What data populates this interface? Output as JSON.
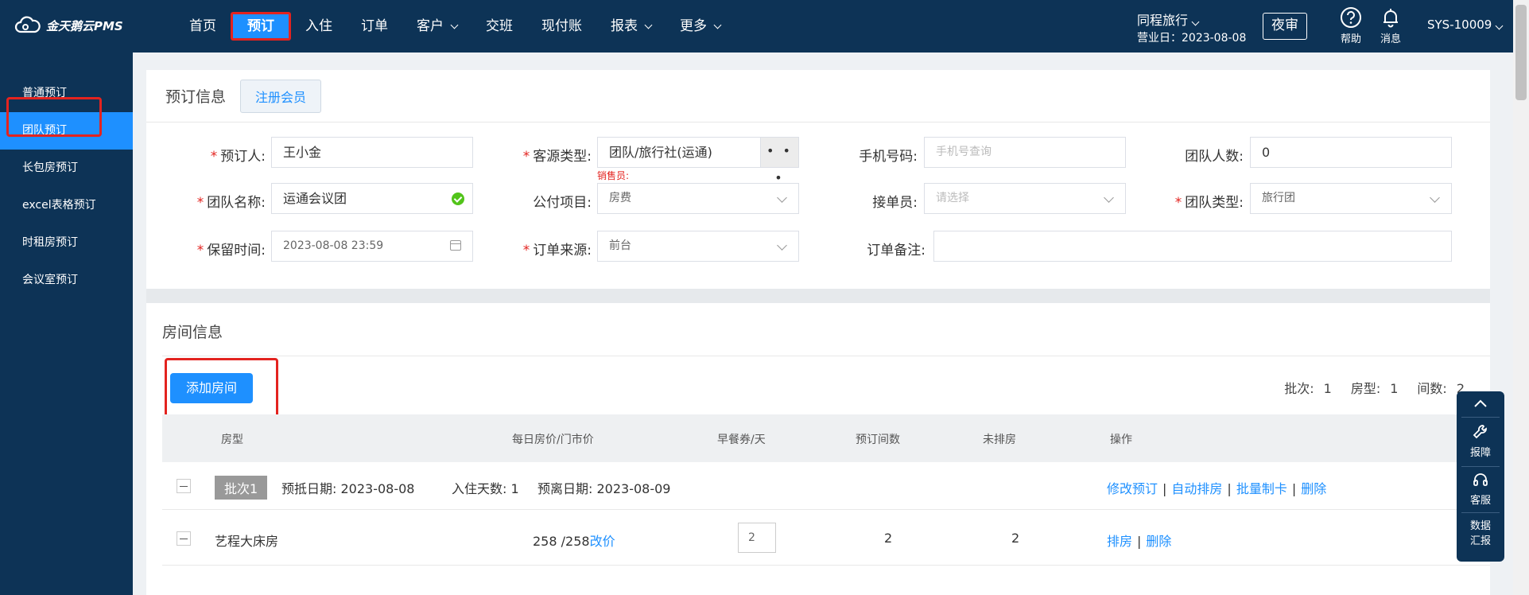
{
  "app": {
    "logo_text": "金天鹅云PMS"
  },
  "nav": {
    "items": [
      {
        "label": "首页",
        "caret": false
      },
      {
        "label": "预订",
        "caret": false,
        "active": true
      },
      {
        "label": "入住",
        "caret": false
      },
      {
        "label": "订单",
        "caret": false
      },
      {
        "label": "客户",
        "caret": true
      },
      {
        "label": "交班",
        "caret": false
      },
      {
        "label": "现付账",
        "caret": false
      },
      {
        "label": "报表",
        "caret": true
      },
      {
        "label": "更多",
        "caret": true
      }
    ]
  },
  "header": {
    "hotel_name": "同程旅行",
    "business_date": "营业日：2023-08-08",
    "night_audit": "夜审",
    "help_label": "帮助",
    "message_label": "消息",
    "user": "SYS-10009"
  },
  "sidebar": {
    "items": [
      {
        "label": "普通预订"
      },
      {
        "label": "团队预订",
        "active": true
      },
      {
        "label": "长包房预订"
      },
      {
        "label": "excel表格预订"
      },
      {
        "label": "时租房预订"
      },
      {
        "label": "会议室预订"
      }
    ]
  },
  "booking": {
    "title": "预订信息",
    "register_member": "注册会员",
    "booker_label": "预订人:",
    "booker_value": "王小金",
    "source_label": "客源类型:",
    "source_value": "团队/旅行社(运通)",
    "dots": "• • •",
    "sales_label": "销售员:",
    "phone_label": "手机号码:",
    "phone_placeholder": "手机号查询",
    "team_size_label": "团队人数:",
    "team_size_value": "0",
    "team_name_label": "团队名称:",
    "team_name_value": "运通会议团",
    "payment_label": "公付项目:",
    "payment_value": "房费",
    "receiver_label": "接单员:",
    "receiver_placeholder": "请选择",
    "team_type_label": "团队类型:",
    "team_type_value": "旅行团",
    "hold_label": "保留时间:",
    "hold_value": "2023-08-08 23:59",
    "order_source_label": "订单来源:",
    "order_source_value": "前台",
    "remark_label": "订单备注:",
    "remark_value": ""
  },
  "rooms": {
    "title": "房间信息",
    "add_button": "添加房间",
    "stats": {
      "batch_label": "批次:",
      "batch": "1",
      "type_label": "房型:",
      "type": "1",
      "count_label": "间数:",
      "count": "2"
    },
    "columns": [
      "房型",
      "每日房价/门市价",
      "早餐券/天",
      "预订间数",
      "未排房",
      "操作"
    ],
    "batch_row": {
      "tag": "批次1",
      "arrive": "预抵日期:  2023-08-08",
      "days": "入住天数:  1",
      "depart": "预离日期:  2023-08-09",
      "actions": [
        "修改预订",
        "自动排房",
        "批量制卡",
        "删除"
      ]
    },
    "room_row": {
      "type": "艺程大床房",
      "price": "258 /258",
      "change_price": "改价",
      "breakfast": "2",
      "booked": "2",
      "unassigned": "2",
      "actions": [
        "排房",
        "删除"
      ]
    }
  },
  "float_bar": {
    "report": "报障",
    "service": "客服",
    "data_report": "数据汇报"
  },
  "colors": {
    "topbar": "#0d3356",
    "accent": "#1e90ff",
    "highlight": "#e3231f"
  }
}
